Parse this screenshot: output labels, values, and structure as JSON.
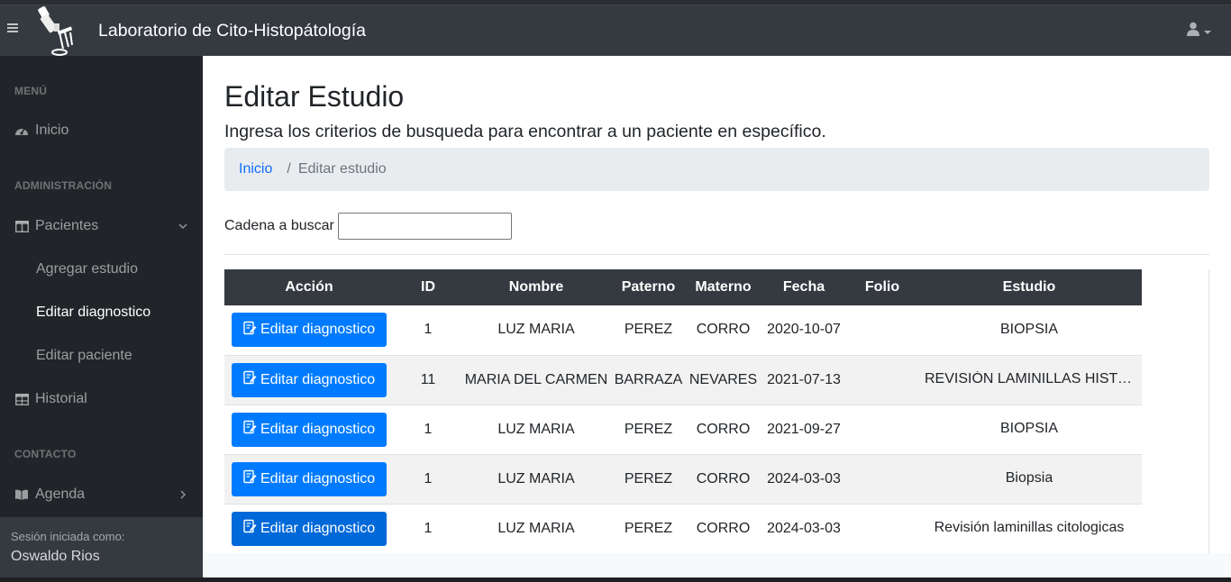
{
  "navbar": {
    "brand": "Laboratorio de Cito-Histopátología",
    "menu_icon": "hamburger-icon",
    "logo_icon": "microscope-icon",
    "user_icon": "user-icon"
  },
  "sidebar": {
    "heading_menu": "MENÚ",
    "heading_admin": "ADMINISTRACIÓN",
    "heading_contact": "CONTACTO",
    "items": [
      {
        "label": "Inicio",
        "icon": "tachometer-icon"
      },
      {
        "label": "Pacientes",
        "icon": "columns-icon"
      },
      {
        "label": "Agregar estudio"
      },
      {
        "label": "Editar diagnostico"
      },
      {
        "label": "Editar paciente"
      },
      {
        "label": "Historial",
        "icon": "table-icon"
      },
      {
        "label": "Agenda",
        "icon": "book-icon"
      }
    ],
    "footer": {
      "caption": "Sesión iniciada como:",
      "user": "Oswaldo Rios"
    }
  },
  "main": {
    "title": "Editar Estudio",
    "subtitle": "Ingresa los criterios de busqueda para encontrar a un paciente en específico.",
    "breadcrumb": {
      "home": "Inicio",
      "separator": "/",
      "current": "Editar estudio"
    },
    "search": {
      "label": "Cadena a buscar",
      "value": ""
    }
  },
  "table": {
    "headers": [
      "Acción",
      "ID",
      "Nombre",
      "Paterno",
      "Materno",
      "Fecha",
      "Folio",
      "Estudio"
    ],
    "button_label": "Editar diagnostico",
    "rows": [
      {
        "id": "1",
        "nombre": "LUZ MARIA",
        "paterno": "PEREZ",
        "materno": "CORRO",
        "fecha": "2020-10-07",
        "folio": "",
        "estudio": "BIOPSIA"
      },
      {
        "id": "11",
        "nombre": "MARIA DEL CARMEN",
        "paterno": "BARRAZA",
        "materno": "NEVARES",
        "fecha": "2021-07-13",
        "folio": "",
        "estudio": "REVISIÓN LAMINILLAS HISTOL..."
      },
      {
        "id": "1",
        "nombre": "LUZ MARIA",
        "paterno": "PEREZ",
        "materno": "CORRO",
        "fecha": "2021-09-27",
        "folio": "",
        "estudio": "BIOPSIA"
      },
      {
        "id": "1",
        "nombre": "LUZ MARIA",
        "paterno": "PEREZ",
        "materno": "CORRO",
        "fecha": "2024-03-03",
        "folio": "",
        "estudio": "Biopsia"
      },
      {
        "id": "1",
        "nombre": "LUZ MARIA",
        "paterno": "PEREZ",
        "materno": "CORRO",
        "fecha": "2024-03-03",
        "folio": "",
        "estudio": "Revisión laminillas citologicas"
      }
    ]
  },
  "colors": {
    "navbar": "#343a40",
    "sidebar": "#212529",
    "primary": "#007bff",
    "table_header": "#343a40"
  }
}
